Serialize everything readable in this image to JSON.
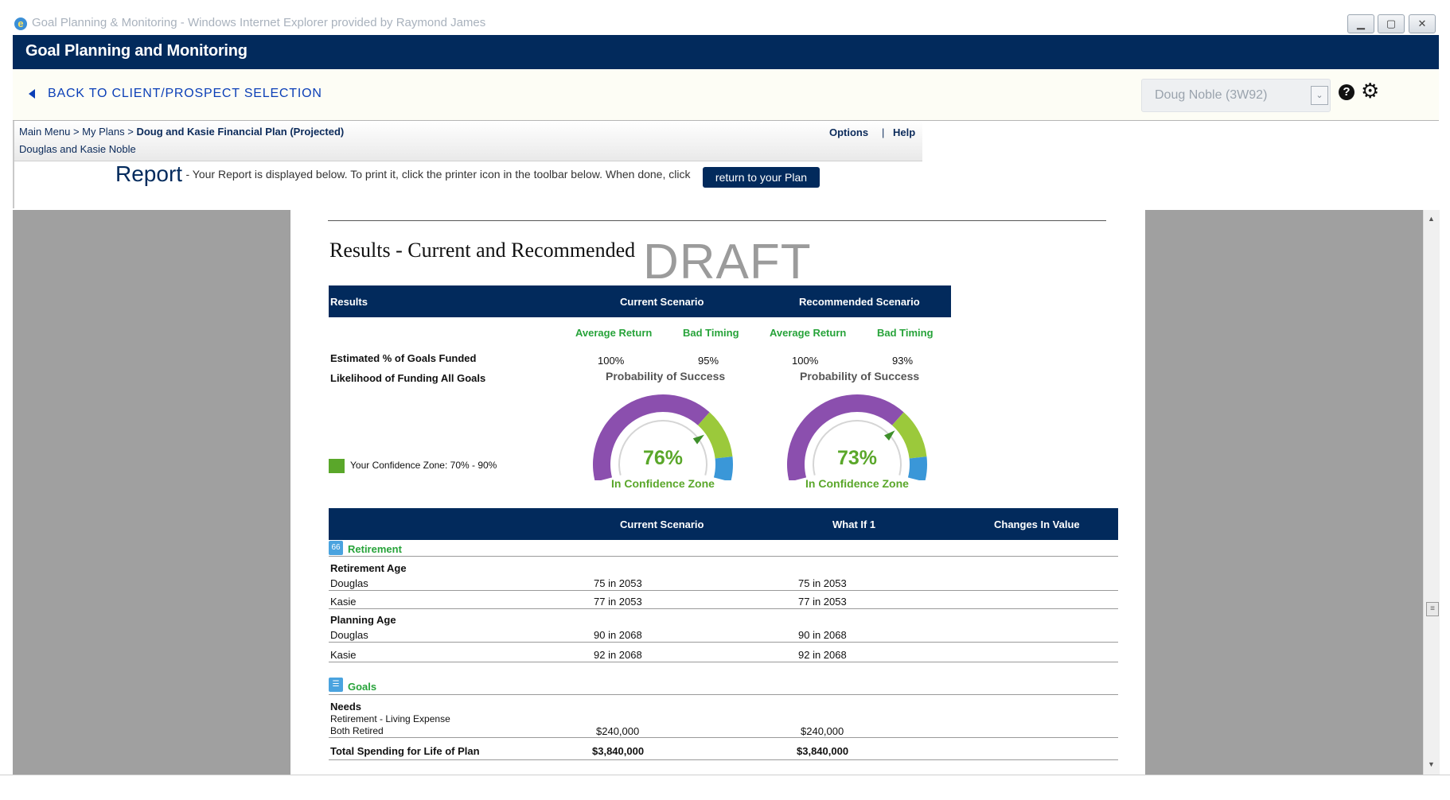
{
  "window": {
    "title": "Goal Planning & Monitoring - Windows Internet Explorer provided by Raymond James"
  },
  "app": {
    "title": "Goal Planning and Monitoring"
  },
  "nav": {
    "back_label": "BACK TO CLIENT/PROSPECT SELECTION",
    "client_select_value": "Doug Noble (3W92)"
  },
  "breadcrumb": {
    "main_menu": "Main Menu",
    "sep": ">",
    "my_plans": "My Plans",
    "current": "Doug and Kasie Financial Plan (Projected)",
    "client_names": "Douglas and Kasie Noble",
    "options": "Options",
    "pipe": "|",
    "help": "Help"
  },
  "report_header": {
    "title": "Report",
    "instructions": "- Your Report is displayed below. To print it, click the printer icon in the toolbar below. When done, click",
    "return_button": "return to your Plan"
  },
  "report": {
    "title": "Results - Current and Recommended",
    "watermark": "DRAFT",
    "results_header": {
      "col1": "Results",
      "col2": "Current Scenario",
      "col3": "Recommended Scenario"
    },
    "subheads": {
      "avg": "Average Return",
      "bad": "Bad Timing"
    },
    "row_goals_funded": "Estimated % of Goals Funded",
    "row_likelihood": "Likelihood of Funding All Goals",
    "current": {
      "avg": "100%",
      "bad": "95%",
      "pos_label": "Probability of Success",
      "pct": "76%",
      "zone": "In Confidence Zone"
    },
    "recommended": {
      "avg": "100%",
      "bad": "93%",
      "pos_label": "Probability of Success",
      "pct": "73%",
      "zone": "In Confidence Zone"
    },
    "confidence_zone": "Your Confidence Zone: 70% - 90%",
    "compare_header": {
      "col2": "Current Scenario",
      "col3": "What If 1",
      "col4": "Changes In Value"
    },
    "retirement_section": "Retirement",
    "retirement_age_label": "Retirement Age",
    "planning_age_label": "Planning Age",
    "rows": {
      "ret_douglas": {
        "name": "Douglas",
        "cur": "75 in 2053",
        "whatif": "75 in 2053"
      },
      "ret_kasie": {
        "name": "Kasie",
        "cur": "77 in 2053",
        "whatif": "77 in 2053"
      },
      "plan_douglas": {
        "name": "Douglas",
        "cur": "90 in 2068",
        "whatif": "90 in 2068"
      },
      "plan_kasie": {
        "name": "Kasie",
        "cur": "92 in 2068",
        "whatif": "92 in 2068"
      }
    },
    "goals_section": "Goals",
    "needs_label": "Needs",
    "goal_line1": "Retirement - Living Expense",
    "goal_line2": "Both Retired",
    "goal_cur": "$240,000",
    "goal_whatif": "$240,000",
    "total_label": "Total Spending for Life of Plan",
    "total_cur": "$3,840,000",
    "total_whatif": "$3,840,000"
  },
  "colors": {
    "navy": "#022a5c",
    "green": "#27a33a",
    "gauge_purple": "#8b4fae",
    "gauge_lime": "#9bc93b",
    "gauge_blue": "#3a97d8"
  },
  "gauge_values": {
    "current": 0.76,
    "recommended": 0.73
  }
}
